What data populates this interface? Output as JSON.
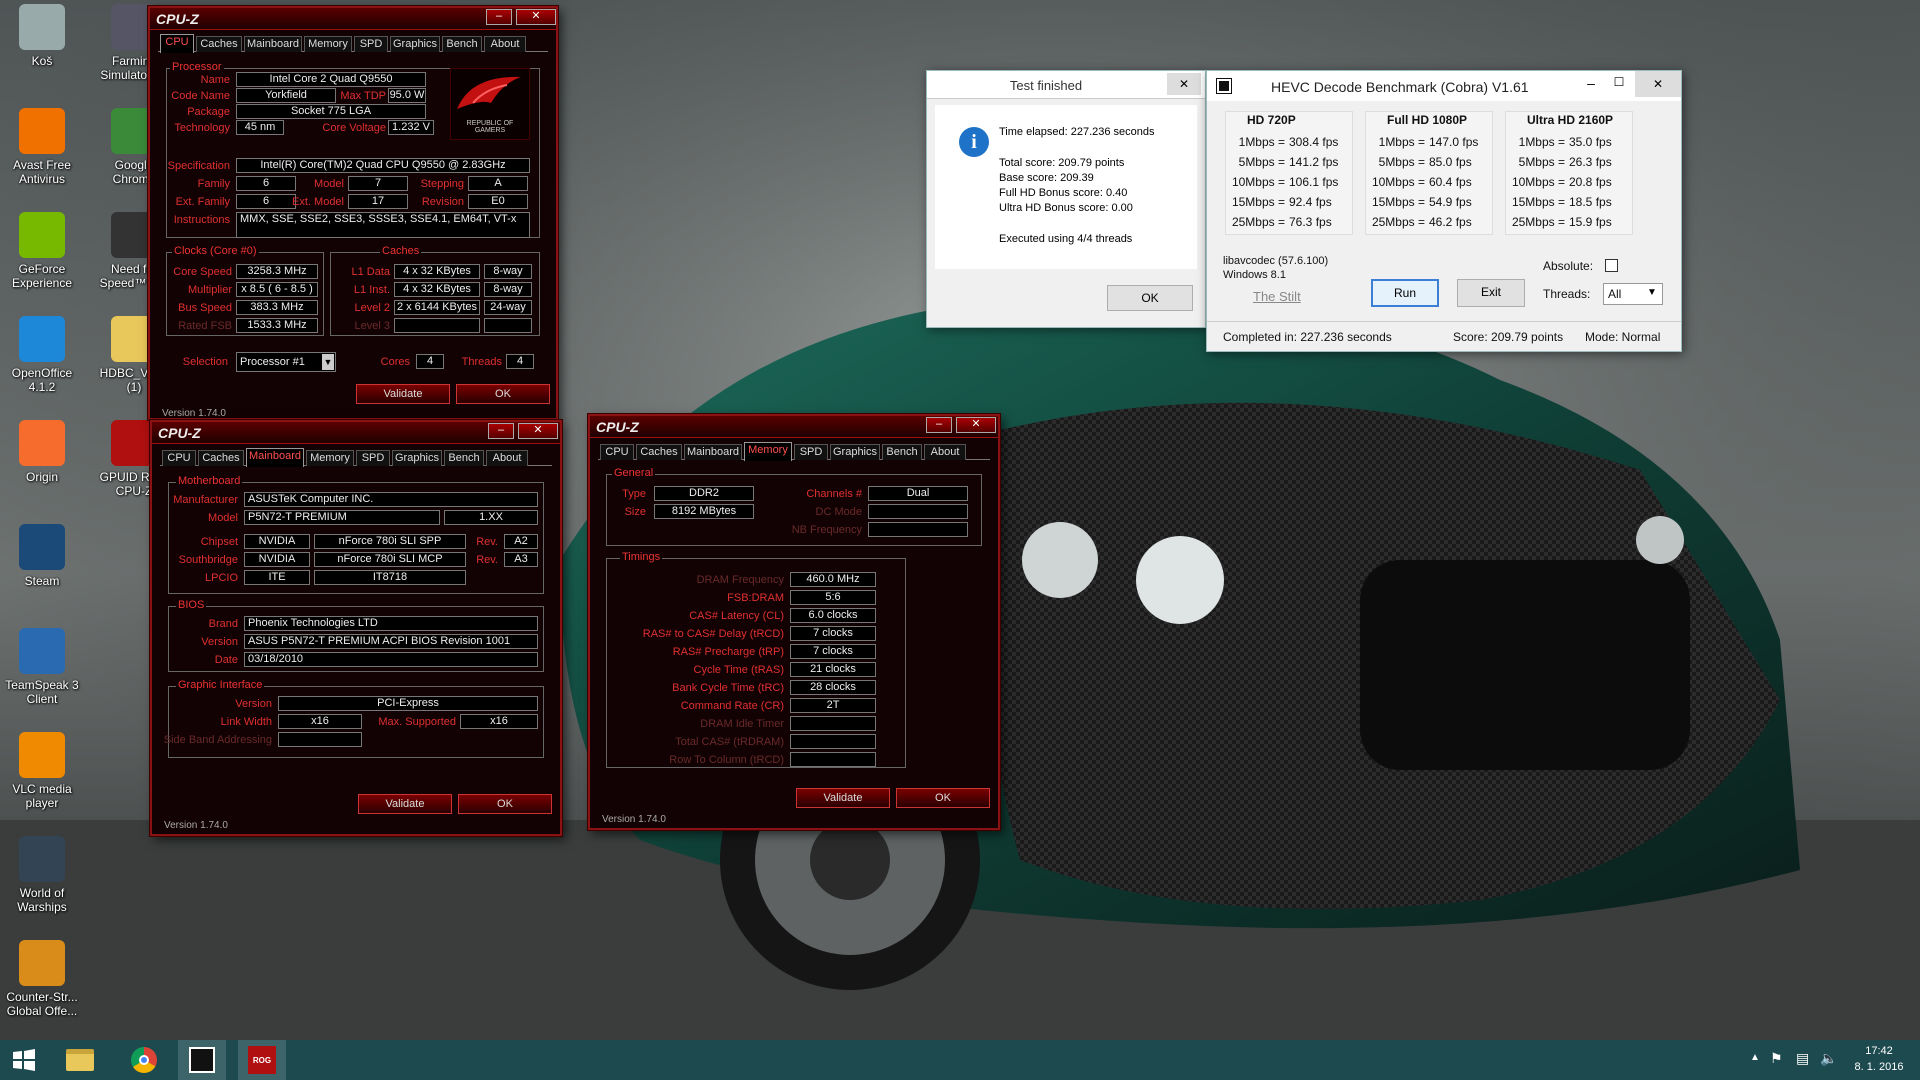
{
  "desktop": {
    "icons": [
      {
        "label": "Koš",
        "icon": "recycle-bin-icon",
        "color": "#9aa"
      },
      {
        "label": "Farming Simulator 15",
        "icon": "tractor-icon",
        "color": "#556"
      },
      {
        "label": "Avast Free Antivirus",
        "icon": "avast-icon",
        "color": "#f07000"
      },
      {
        "label": "Google Chrome",
        "icon": "chrome-icon",
        "color": "#3a8a3a"
      },
      {
        "label": "GeForce Experience",
        "icon": "nvidia-icon",
        "color": "#76b900"
      },
      {
        "label": "Need for Speed™ H...",
        "icon": "nfs-icon",
        "color": "#333"
      },
      {
        "label": "OpenOffice 4.1.2",
        "icon": "openoffice-icon",
        "color": "#1e88d8"
      },
      {
        "label": "HDBC_V161 (1)",
        "icon": "folder-icon",
        "color": "#e8c85a"
      },
      {
        "label": "Origin",
        "icon": "origin-icon",
        "color": "#f56c2d"
      },
      {
        "label": "GPUID ROG CPU-Z",
        "icon": "rog-cpuz-icon",
        "color": "#b01010"
      },
      {
        "label": "Steam",
        "icon": "steam-icon",
        "color": "#1b4a78"
      },
      {
        "label": "TeamSpeak 3 Client",
        "icon": "teamspeak-icon",
        "color": "#2a6ab0"
      },
      {
        "label": "VLC media player",
        "icon": "vlc-icon",
        "color": "#f08a00"
      },
      {
        "label": "World of Warships",
        "icon": "warships-icon",
        "color": "#345"
      },
      {
        "label": "Counter-Str... Global Offe...",
        "icon": "csgo-icon",
        "color": "#d98c1a"
      }
    ]
  },
  "cpuz_cpu": {
    "title": "CPU-Z",
    "tabs": [
      "CPU",
      "Caches",
      "Mainboard",
      "Memory",
      "SPD",
      "Graphics",
      "Bench",
      "About"
    ],
    "processor_group": "Processor",
    "labels": {
      "name": "Name",
      "codename": "Code Name",
      "maxtdp": "Max TDP",
      "package": "Package",
      "technology": "Technology",
      "corevoltage": "Core Voltage",
      "spec": "Specification",
      "family": "Family",
      "model": "Model",
      "stepping": "Stepping",
      "extfamily": "Ext. Family",
      "extmodel": "Ext. Model",
      "revision": "Revision",
      "instructions": "Instructions"
    },
    "values": {
      "name": "Intel Core 2 Quad Q9550",
      "codename": "Yorkfield",
      "maxtdp": "95.0 W",
      "package": "Socket 775 LGA",
      "technology": "45 nm",
      "corevoltage": "1.232 V",
      "spec": "Intel(R) Core(TM)2 Quad CPU    Q9550  @ 2.83GHz",
      "family": "6",
      "model": "7",
      "stepping": "A",
      "extfamily": "6",
      "extmodel": "17",
      "revision": "E0",
      "instructions": "MMX, SSE, SSE2, SSE3, SSSE3, SSE4.1, EM64T, VT-x"
    },
    "clocks_group": "Clocks (Core #0)",
    "clock_labels": {
      "corespeed": "Core Speed",
      "multiplier": "Multiplier",
      "busspeed": "Bus Speed",
      "ratedfsb": "Rated FSB"
    },
    "clock_values": {
      "corespeed": "3258.3 MHz",
      "multiplier": "x 8.5 ( 6 - 8.5 )",
      "busspeed": "383.3 MHz",
      "ratedfsb": "1533.3 MHz"
    },
    "caches_group": "Caches",
    "cache_labels": {
      "l1d": "L1 Data",
      "l1i": "L1 Inst.",
      "l2": "Level 2",
      "l3": "Level 3"
    },
    "cache_values": {
      "l1d": "4 x 32 KBytes",
      "l1d_way": "8-way",
      "l1i": "4 x 32 KBytes",
      "l1i_way": "8-way",
      "l2": "2 x 6144 KBytes",
      "l2_way": "24-way"
    },
    "selection_label": "Selection",
    "selection_value": "Processor #1",
    "cores_label": "Cores",
    "cores": "4",
    "threads_label": "Threads",
    "threads": "4",
    "validate": "Validate",
    "ok": "OK",
    "version": "Version 1.74.0",
    "logo_text": "REPUBLIC OF GAMERS"
  },
  "cpuz_mb": {
    "title": "CPU-Z",
    "motherboard_group": "Motherboard",
    "labels": {
      "manufacturer": "Manufacturer",
      "model": "Model",
      "chipset": "Chipset",
      "southbridge": "Southbridge",
      "lpcio": "LPCIO",
      "rev": "Rev."
    },
    "values": {
      "manufacturer": "ASUSTeK Computer INC.",
      "model": "P5N72-T PREMIUM",
      "model_rev": "1.XX",
      "chipset_vendor": "NVIDIA",
      "chipset": "nForce 780i SLI SPP",
      "chipset_rev": "A2",
      "sb_vendor": "NVIDIA",
      "sb": "nForce 780i SLI MCP",
      "sb_rev": "A3",
      "lpcio_vendor": "ITE",
      "lpcio": "IT8718"
    },
    "bios_group": "BIOS",
    "bios_labels": {
      "brand": "Brand",
      "version": "Version",
      "date": "Date"
    },
    "bios_values": {
      "brand": "Phoenix Technologies LTD",
      "version": "ASUS P5N72-T PREMIUM ACPI BIOS Revision 1001",
      "date": "03/18/2010"
    },
    "gi_group": "Graphic Interface",
    "gi_labels": {
      "version": "Version",
      "linkwidth": "Link Width",
      "maxsupported": "Max. Supported",
      "sideband": "Side Band Addressing"
    },
    "gi_values": {
      "version": "PCI-Express",
      "linkwidth": "x16",
      "maxsupported": "x16"
    },
    "validate": "Validate",
    "ok": "OK",
    "version": "Version 1.74.0"
  },
  "cpuz_mem": {
    "title": "CPU-Z",
    "general_group": "General",
    "labels": {
      "type": "Type",
      "size": "Size",
      "channels": "Channels #",
      "dcmode": "DC Mode",
      "nbfreq": "NB Frequency"
    },
    "values": {
      "type": "DDR2",
      "size": "8192 MBytes",
      "channels": "Dual"
    },
    "timings_group": "Timings",
    "timings": [
      {
        "label": "DRAM Frequency",
        "value": "460.0 MHz",
        "dim": true
      },
      {
        "label": "FSB:DRAM",
        "value": "5:6",
        "dim": false
      },
      {
        "label": "CAS# Latency (CL)",
        "value": "6.0 clocks",
        "dim": false
      },
      {
        "label": "RAS# to CAS# Delay (tRCD)",
        "value": "7 clocks",
        "dim": false
      },
      {
        "label": "RAS# Precharge (tRP)",
        "value": "7 clocks",
        "dim": false
      },
      {
        "label": "Cycle Time (tRAS)",
        "value": "21 clocks",
        "dim": false
      },
      {
        "label": "Bank Cycle Time (tRC)",
        "value": "28 clocks",
        "dim": false
      },
      {
        "label": "Command Rate (CR)",
        "value": "2T",
        "dim": false
      },
      {
        "label": "DRAM Idle Timer",
        "value": "",
        "dim": true
      },
      {
        "label": "Total CAS# (tRDRAM)",
        "value": "",
        "dim": true
      },
      {
        "label": "Row To Column (tRCD)",
        "value": "",
        "dim": true
      }
    ],
    "validate": "Validate",
    "ok": "OK",
    "version": "Version 1.74.0"
  },
  "test_dialog": {
    "title": "Test finished",
    "close": "✕",
    "lines": [
      "Time elapsed:  227.236 seconds",
      "Total score:  209.79 points",
      "Base score: 209.39",
      "Full HD Bonus score: 0.40",
      "Ultra HD Bonus score: 0.00",
      "Executed using 4/4 threads"
    ],
    "ok": "OK"
  },
  "hevc": {
    "title": "HEVC Decode Benchmark (Cobra) V1.61",
    "columns": [
      {
        "header": "HD 720P",
        "rows": [
          {
            "k": "1Mbps =",
            "v": "308.4 fps"
          },
          {
            "k": "5Mbps =",
            "v": "141.2 fps"
          },
          {
            "k": "10Mbps =",
            "v": "106.1 fps"
          },
          {
            "k": "15Mbps =",
            "v": "92.4 fps"
          },
          {
            "k": "25Mbps =",
            "v": "76.3 fps"
          }
        ]
      },
      {
        "header": "Full HD 1080P",
        "rows": [
          {
            "k": "1Mbps =",
            "v": "147.0 fps"
          },
          {
            "k": "5Mbps =",
            "v": "85.0 fps"
          },
          {
            "k": "10Mbps =",
            "v": "60.4 fps"
          },
          {
            "k": "15Mbps =",
            "v": "54.9 fps"
          },
          {
            "k": "25Mbps =",
            "v": "46.2 fps"
          }
        ]
      },
      {
        "header": "Ultra HD 2160P",
        "rows": [
          {
            "k": "1Mbps =",
            "v": "35.0 fps"
          },
          {
            "k": "5Mbps =",
            "v": "26.3 fps"
          },
          {
            "k": "10Mbps =",
            "v": "20.8 fps"
          },
          {
            "k": "15Mbps =",
            "v": "18.5 fps"
          },
          {
            "k": "25Mbps =",
            "v": "15.9 fps"
          }
        ]
      }
    ],
    "codec": "libavcodec (57.6.100)",
    "os": "Windows 8.1",
    "link": "The Stilt",
    "run": "Run",
    "exit": "Exit",
    "absolute_label": "Absolute:",
    "threads_label": "Threads:",
    "threads_value": "All",
    "status_completed": "Completed in: 227.236 seconds",
    "status_score": "Score: 209.79 points",
    "status_mode": "Mode: Normal"
  },
  "taskbar": {
    "time": "17:42",
    "date": "8. 1. 2016"
  }
}
